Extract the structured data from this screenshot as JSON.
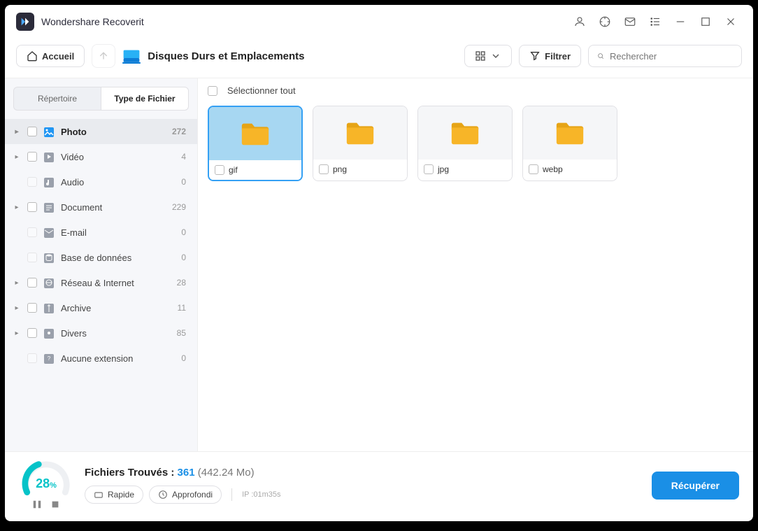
{
  "titlebar": {
    "app_name": "Wondershare Recoverit"
  },
  "toolbar": {
    "home_label": "Accueil",
    "breadcrumb": "Disques Durs et Emplacements",
    "filter_label": "Filtrer",
    "search_placeholder": "Rechercher"
  },
  "sidebar": {
    "tabs": {
      "repertoire": "Répertoire",
      "type_fichier": "Type de Fichier"
    },
    "items": [
      {
        "label": "Photo",
        "count": "272",
        "expandable": true,
        "selected": true,
        "icon": "image",
        "cb": true
      },
      {
        "label": "Vidéo",
        "count": "4",
        "expandable": true,
        "icon": "video",
        "cb": true
      },
      {
        "label": "Audio",
        "count": "0",
        "expandable": false,
        "icon": "audio",
        "cb": false
      },
      {
        "label": "Document",
        "count": "229",
        "expandable": true,
        "icon": "doc",
        "cb": true
      },
      {
        "label": "E-mail",
        "count": "0",
        "expandable": false,
        "icon": "mail",
        "cb": false
      },
      {
        "label": "Base de données",
        "count": "0",
        "expandable": false,
        "icon": "db",
        "cb": false
      },
      {
        "label": "Réseau & Internet",
        "count": "28",
        "expandable": true,
        "icon": "net",
        "cb": true
      },
      {
        "label": "Archive",
        "count": "11",
        "expandable": true,
        "icon": "archive",
        "cb": true
      },
      {
        "label": "Divers",
        "count": "85",
        "expandable": true,
        "icon": "other",
        "cb": true
      },
      {
        "label": "Aucune extension",
        "count": "0",
        "expandable": false,
        "icon": "unknown",
        "cb": false
      }
    ]
  },
  "content": {
    "select_all": "Sélectionner tout",
    "cards": [
      {
        "label": "gif",
        "selected": true
      },
      {
        "label": "png",
        "selected": false
      },
      {
        "label": "jpg",
        "selected": false
      },
      {
        "label": "webp",
        "selected": false
      }
    ]
  },
  "footer": {
    "progress_pct": "28",
    "found_prefix": "Fichiers Trouvés : ",
    "found_count": "361",
    "found_size": "(442.24 Mo)",
    "mode_rapid": "Rapide",
    "mode_deep": "Approfondi",
    "ip_info": "IP :01m35s",
    "recover": "Récupérer"
  }
}
